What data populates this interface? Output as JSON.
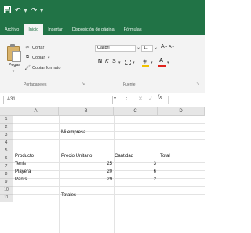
{
  "quick_access": {
    "save_icon": "save-icon",
    "undo_icon": "undo-icon",
    "redo_icon": "redo-icon"
  },
  "tabs": [
    {
      "label": "Archivo",
      "active": false
    },
    {
      "label": "Inicio",
      "active": true
    },
    {
      "label": "Insertar",
      "active": false
    },
    {
      "label": "Disposición de página",
      "active": false
    },
    {
      "label": "Fórmulas",
      "active": false
    }
  ],
  "ribbon": {
    "clipboard": {
      "paste_label": "Pegar",
      "cut_label": "Cortar",
      "copy_label": "Copiar",
      "copy_format_label": "Copiar formato",
      "group_label": "Portapapeles"
    },
    "font": {
      "font_name": "Calibri",
      "font_size": "11",
      "bold": "N",
      "italic": "K",
      "underline": "S",
      "group_label": "Fuente",
      "fill_color": "#f2c200",
      "font_color": "#e0221c"
    }
  },
  "formula_bar": {
    "name_box": "A31",
    "fx_label": "fx",
    "cancel_symbol": "✕",
    "enter_symbol": "✓",
    "content": ""
  },
  "sheet": {
    "columns": [
      "A",
      "B",
      "C",
      "D"
    ],
    "rows": [
      "1",
      "2",
      "3",
      "4",
      "5",
      "6",
      "7",
      "8",
      "9",
      "10",
      "11"
    ],
    "cells": {
      "B2": "Mi empresa",
      "A5": "Producto",
      "B5": "Precio Unitario",
      "C5": "Cantidad",
      "D5": "Total",
      "A6": "Tenis",
      "B6": "25",
      "C6": "3",
      "A7": "Playera",
      "B7": "20",
      "C7": "6",
      "A8": "Pants",
      "B8": "29",
      "C8": "2",
      "B10": "Totales"
    }
  },
  "colors": {
    "excel_green": "#217346",
    "ribbon_bg": "#f3f3f3"
  }
}
